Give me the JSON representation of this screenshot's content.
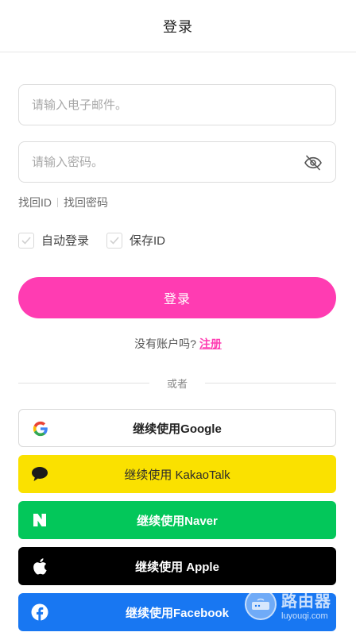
{
  "header": {
    "title": "登录"
  },
  "form": {
    "email_placeholder": "请输入电子邮件。",
    "password_placeholder": "请输入密码。",
    "find_id": "找回ID",
    "find_password": "找回密码",
    "auto_login": "自动登录",
    "save_id": "保存ID",
    "login_button": "登录"
  },
  "signup": {
    "prompt": "没有账户吗?",
    "link": "注册"
  },
  "divider": {
    "text": "或者"
  },
  "social": {
    "google": "继续使用Google",
    "kakao": "继续使用 KakaoTalk",
    "naver": "继续使用Naver",
    "apple": "继续使用 Apple",
    "facebook": "继续使用Facebook"
  },
  "icons": {
    "password_toggle": "eye-off-icon",
    "google": "google-icon",
    "kakao": "kakao-chat-bubble-icon",
    "naver": "naver-n-icon",
    "apple": "apple-icon",
    "facebook": "facebook-icon"
  },
  "colors": {
    "accent": "#ff3cb2",
    "kakao": "#fae100",
    "naver": "#03c75a",
    "apple": "#000000",
    "facebook": "#1877f2"
  },
  "watermark": {
    "name": "路由器",
    "domain": "luyouqi.com"
  }
}
